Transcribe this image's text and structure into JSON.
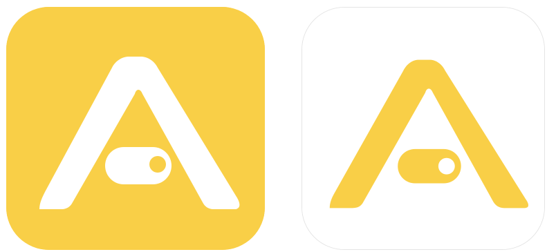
{
  "icons": [
    {
      "variant": "yellow-background",
      "background_color": "#F9CF47",
      "glyph_color": "#FFFFFF",
      "knob_color": "#F9CF47",
      "glyph": "letter-a-with-toggle-switch"
    },
    {
      "variant": "white-background",
      "background_color": "#FFFFFF",
      "glyph_color": "#F9CF47",
      "knob_color": "#FFFFFF",
      "glyph": "letter-a-with-toggle-switch"
    }
  ]
}
